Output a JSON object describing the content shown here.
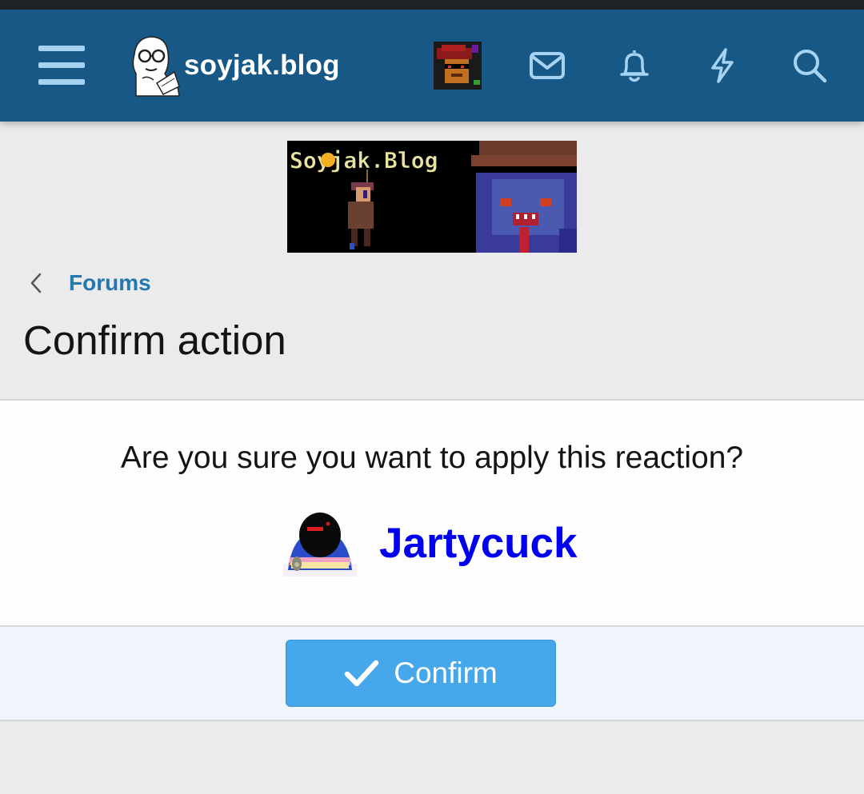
{
  "header": {
    "site_name": "soyjak.blog",
    "icons": [
      "menu-icon",
      "logo-icon",
      "avatar",
      "mail-icon",
      "bell-icon",
      "bolt-icon",
      "search-icon"
    ],
    "background_color": "#185886"
  },
  "banner": {
    "text": "Soyjak.Blog"
  },
  "breadcrumb": {
    "label": "Forums"
  },
  "page": {
    "title": "Confirm action"
  },
  "dialog": {
    "question": "Are you sure you want to apply this reaction?",
    "reaction_name": "Jartycuck",
    "confirm_label": "Confirm"
  },
  "colors": {
    "link": "#2577b1",
    "reaction_link": "#0000ee",
    "button": "#47a7eb",
    "footer": "#eff5fb"
  }
}
